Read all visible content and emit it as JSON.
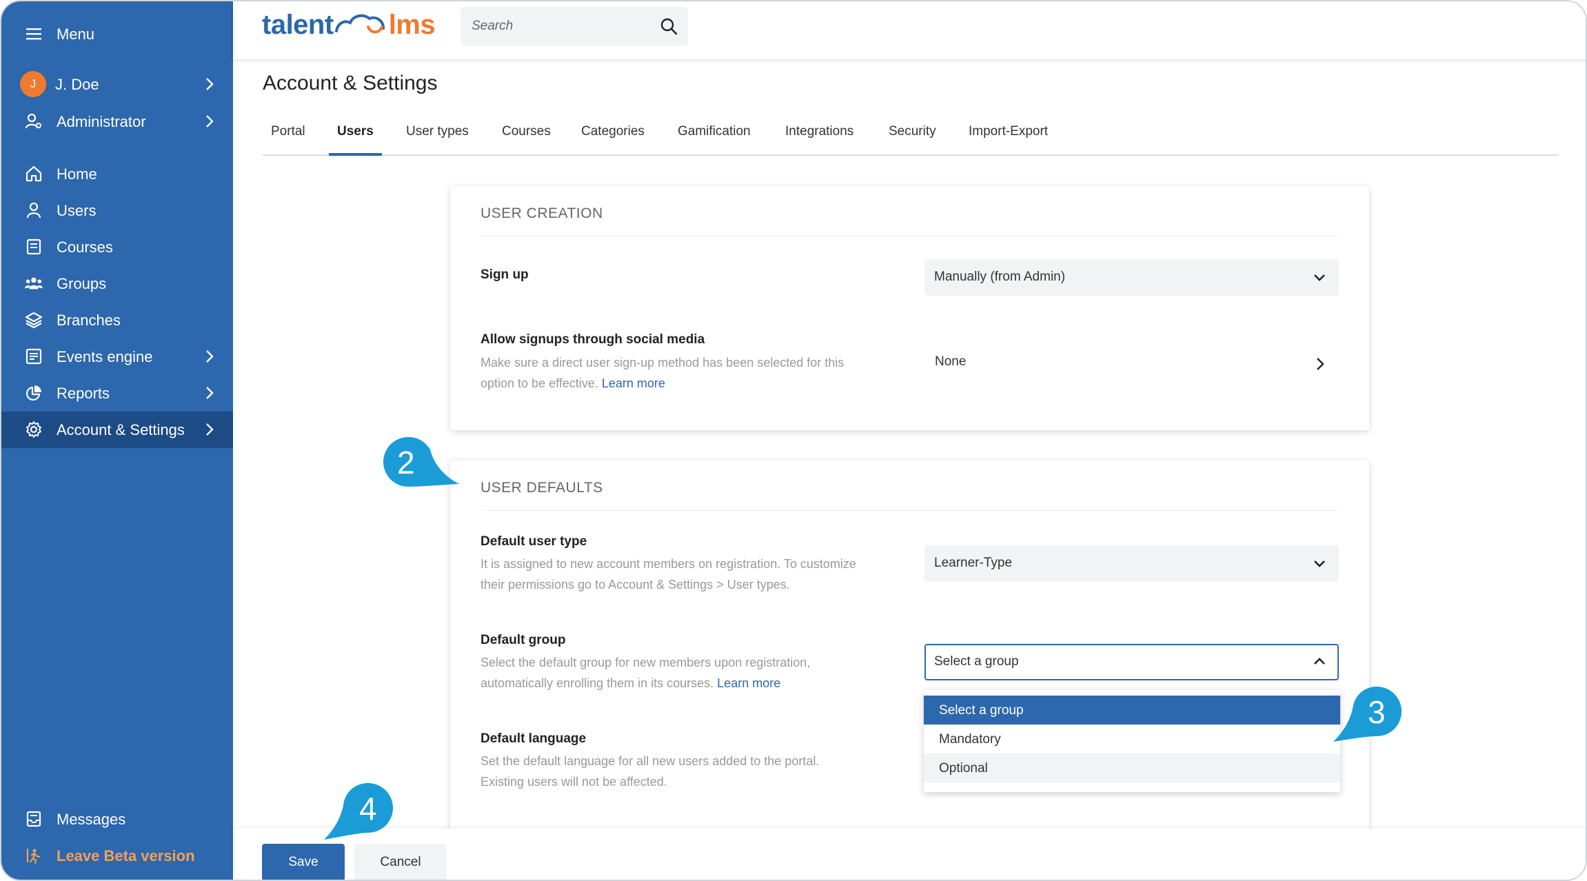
{
  "sidebar": {
    "menu_label": "Menu",
    "user_initial": "J",
    "user_name": "J. Doe",
    "role": "Administrator",
    "items": [
      {
        "label": "Home",
        "icon": "home-icon"
      },
      {
        "label": "Users",
        "icon": "user-icon"
      },
      {
        "label": "Courses",
        "icon": "book-icon"
      },
      {
        "label": "Groups",
        "icon": "group-icon"
      },
      {
        "label": "Branches",
        "icon": "layers-icon"
      },
      {
        "label": "Events engine",
        "icon": "events-icon"
      },
      {
        "label": "Reports",
        "icon": "pie-chart-icon"
      },
      {
        "label": "Account & Settings",
        "icon": "gear-icon"
      }
    ],
    "messages": "Messages",
    "leave_beta": "Leave Beta version"
  },
  "topbar": {
    "logo_left": "talent",
    "logo_right": "lms",
    "search_placeholder": "Search"
  },
  "page": {
    "title": "Account & Settings",
    "tabs": [
      "Portal",
      "Users",
      "User types",
      "Courses",
      "Categories",
      "Gamification",
      "Integrations",
      "Security",
      "Import-Export"
    ],
    "active_tab": "Users"
  },
  "user_creation": {
    "heading": "USER CREATION",
    "signup_label": "Sign up",
    "signup_value": "Manually (from Admin)",
    "social_label": "Allow signups through social media",
    "social_desc_1": "Make sure a direct user sign-up method has been selected for this",
    "social_desc_2": "option to be effective.",
    "social_link": "Learn more",
    "social_value": "None"
  },
  "user_defaults": {
    "heading": "USER DEFAULTS",
    "type_label": "Default user type",
    "type_desc_1": "It is assigned to new account members on registration. To customize",
    "type_desc_2": "their permissions go to Account & Settings > User types.",
    "type_value": "Learner-Type",
    "group_label": "Default group",
    "group_desc_1": "Select the default group for new members upon registration,",
    "group_desc_2": "automatically enrolling them in its courses.",
    "group_link": "Learn more",
    "group_value": "Select a group",
    "group_options": [
      "Select a group",
      "Mandatory",
      "Optional"
    ],
    "lang_label": "Default language",
    "lang_desc_1": "Set the default language for all new users added to the portal.",
    "lang_desc_2": "Existing users will not be affected."
  },
  "footer": {
    "save": "Save",
    "cancel": "Cancel"
  },
  "callouts": [
    "2",
    "3",
    "4"
  ],
  "colors": {
    "brand_blue": "#2d67ad",
    "sidebar_active": "#1c4b86",
    "accent_orange": "#f07a2e",
    "callout_blue": "#1b9cd6"
  }
}
